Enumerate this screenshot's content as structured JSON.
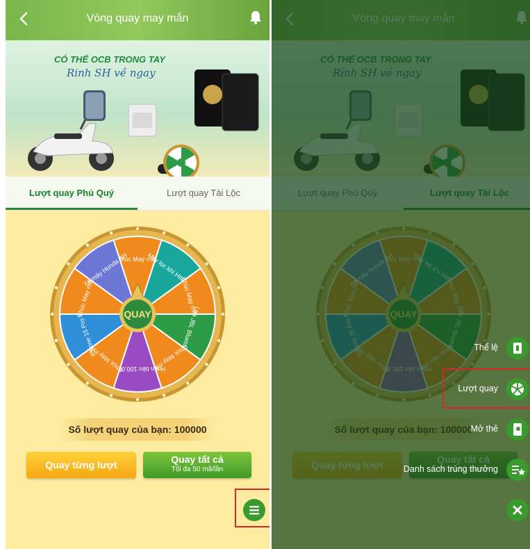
{
  "app": {
    "title": "Vòng quay may mắn"
  },
  "banner": {
    "headline": "CÓ THỂ OCB TRONG TAY",
    "tagline": "Rinh SH về ngay"
  },
  "tabs": [
    {
      "label": "Lượt quay Phú Quý"
    },
    {
      "label": "Lượt quay Tài Lộc"
    }
  ],
  "left_screen": {
    "active_tab": 0
  },
  "right_screen": {
    "active_tab": 1
  },
  "wheel": {
    "center_label": "QUAY",
    "segments": [
      {
        "label": "Chúc May mắn",
        "color": "#f08a1c"
      },
      {
        "label": "Máy lọc khí Hitachi",
        "color": "#19a79b"
      },
      {
        "label": "Chúc May mắn",
        "color": "#f08a1c"
      },
      {
        "label": "Loa JBL Bluetooth",
        "color": "#2e9b47"
      },
      {
        "label": "Chúc May mắn",
        "color": "#f08a1c"
      },
      {
        "label": "Hoàn tiền 100.000 đ",
        "color": "#9a4bc2"
      },
      {
        "label": "Chúc May mắn",
        "color": "#f08a1c"
      },
      {
        "label": "iPhone 15 Pro Max",
        "color": "#2f8fd8"
      },
      {
        "label": "Chúc May mắn",
        "color": "#f08a1c"
      },
      {
        "label": "Xe máy Honda SH",
        "color": "#6d78d6"
      }
    ]
  },
  "spin_count_text": "Số lượt quay của bạn: 100000",
  "buttons": {
    "spin_one": "Quay từng lượt",
    "spin_all": "Quay tất cả",
    "spin_all_sub": "Tối đa 50 mã/lần"
  },
  "fab_menu": [
    {
      "label": "Thể lệ",
      "icon": "rules-book-icon"
    },
    {
      "label": "Lượt quay",
      "icon": "wheel-icon"
    },
    {
      "label": "Mở thẻ",
      "icon": "open-card-icon"
    },
    {
      "label": "Danh sách trúng thưởng",
      "icon": "winners-list-icon"
    }
  ],
  "colors": {
    "primary_green": "#3a9a2e",
    "header_green": "#7ab64a",
    "page_yellow": "#fdeba0",
    "highlight_red": "#d42828",
    "wheel_gold": "#c89530"
  }
}
